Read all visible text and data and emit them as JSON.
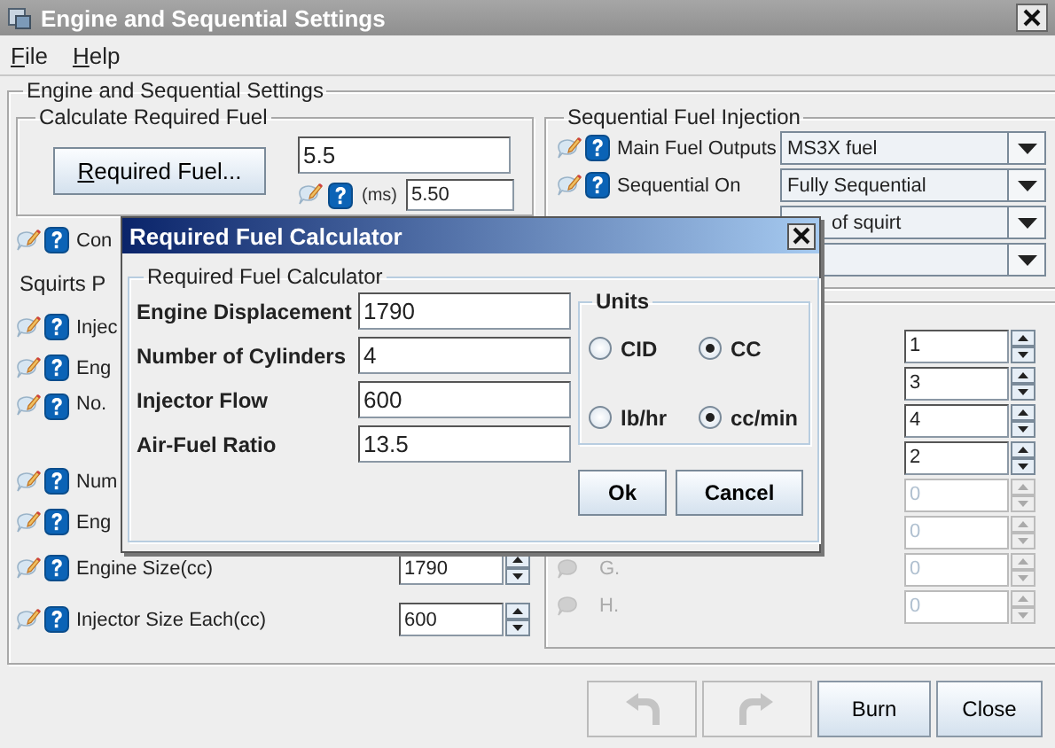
{
  "window": {
    "title": "Engine and Sequential Settings"
  },
  "menu": [
    "File",
    "Help"
  ],
  "main": {
    "title": "Engine and Sequential Settings",
    "required_fuel": {
      "title": "Calculate Required Fuel",
      "button": "Required Fuel...",
      "value": "5.5",
      "unit": "(ms)",
      "ms_value": "5.50"
    },
    "control_row": {
      "label": "Con"
    },
    "squirts": {
      "title": "Squirts P",
      "rows": [
        {
          "kind": "plain",
          "label": "Injec"
        },
        {
          "kind": "plain",
          "label": "Eng"
        },
        {
          "kind": "tall",
          "label": "No."
        },
        {
          "kind": "plain",
          "label": "Num"
        },
        {
          "kind": "plain",
          "label": "Eng"
        },
        {
          "kind": "spinner",
          "label": "Engine Size(cc)",
          "value": "1790"
        },
        {
          "kind": "spinner",
          "label": "Injector Size Each(cc)",
          "value": "600"
        }
      ]
    },
    "sequential": {
      "title": "Sequential Fuel Injection",
      "rows": [
        {
          "kind": "labeled",
          "label": "Main Fuel Outputs",
          "value": "MS3X fuel"
        },
        {
          "kind": "labeled",
          "label": "Sequential On",
          "value": "Fully Sequential"
        },
        {
          "kind": "covered",
          "value": "of squirt"
        },
        {
          "kind": "covered"
        }
      ]
    },
    "spinners": [
      {
        "value": "1",
        "disabled": false
      },
      {
        "value": "3",
        "disabled": false
      },
      {
        "value": "4",
        "disabled": false
      },
      {
        "value": "2",
        "disabled": false
      },
      {
        "value": "0",
        "disabled": true
      },
      {
        "value": "0",
        "disabled": true
      },
      {
        "label": "G.",
        "value": "0",
        "disabled": true
      },
      {
        "label": "H.",
        "value": "0",
        "disabled": true
      }
    ]
  },
  "dialog": {
    "title": "Required Fuel Calculator",
    "group": "Required Fuel Calculator",
    "fields": [
      {
        "label": "Engine Displacement",
        "value": "1790"
      },
      {
        "label": "Number of Cylinders",
        "value": "4"
      },
      {
        "label": "Injector Flow",
        "value": "600"
      },
      {
        "label": "Air-Fuel Ratio",
        "value": "13.5"
      }
    ],
    "units": {
      "title": "Units",
      "options": [
        {
          "label": "CID",
          "selected": false
        },
        {
          "label": "CC",
          "selected": true
        },
        {
          "label": "lb/hr",
          "selected": false
        },
        {
          "label": "cc/min",
          "selected": true
        }
      ]
    },
    "buttons": [
      "Ok",
      "Cancel"
    ]
  },
  "bottom_buttons": [
    {
      "kind": "undo",
      "disabled": true
    },
    {
      "kind": "redo",
      "disabled": true
    },
    {
      "kind": "text",
      "label": "Burn"
    },
    {
      "kind": "text",
      "label": "Close"
    }
  ]
}
